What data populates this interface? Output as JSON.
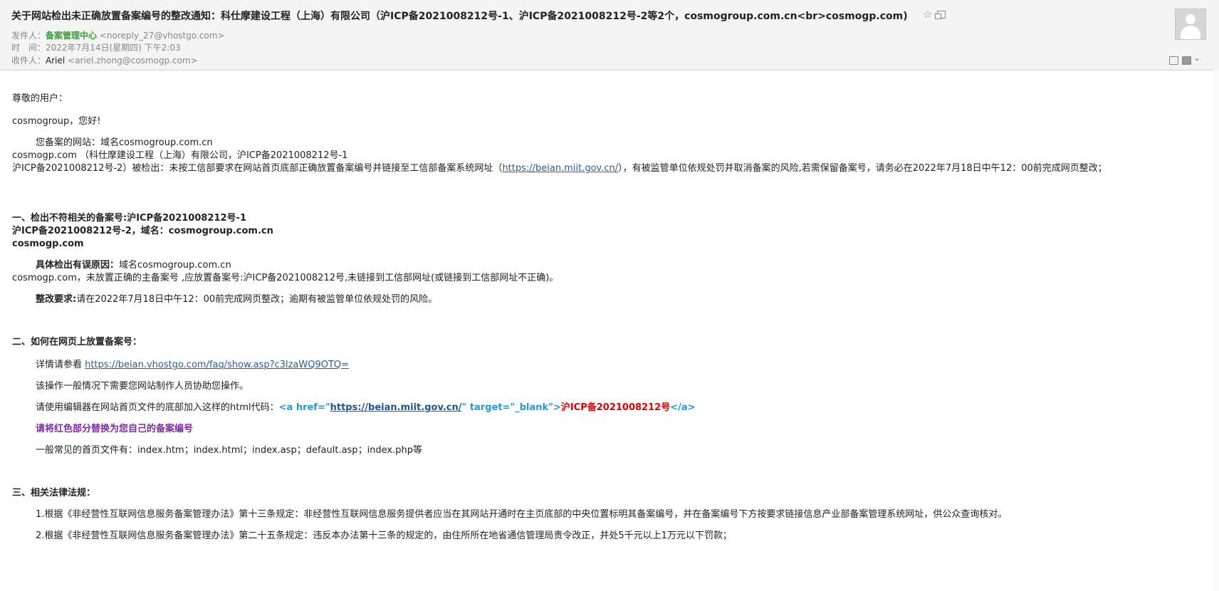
{
  "header": {
    "subject": "关于网站检出未正确放置备案编号的整改通知：科仕摩建设工程（上海）有限公司（沪ICP备2021008212号-1、沪ICP备2021008212号-2等2个，cosmogroup.com.cn<br>cosmogp.com)",
    "from_label": "发件人：",
    "from_name": "备案管理中心",
    "from_addr": "<noreply_27@vhostgo.com>",
    "time_label": "时　间：",
    "time_value": "2022年7月14日(星期四) 下午2:03",
    "to_label": "收件人：",
    "to_name": "Ariel",
    "to_addr": "<ariel.zhong@cosmogp.com>"
  },
  "icons": {
    "star": "star-icon",
    "popout": "popout-icon",
    "avatar": "avatar-icon",
    "note": "note-icon",
    "print": "print-icon",
    "more": "chevron-down-icon"
  },
  "body": {
    "greeting1": "尊敬的用户：",
    "greeting2": "cosmogroup，您好!",
    "p1_line1": "您备案的网站：域名cosmogroup.com.cn",
    "p1_line2": "cosmogp.com （科仕摩建设工程（上海）有限公司，沪ICP备2021008212号-1",
    "p1_line3_a": "沪ICP备2021008212号-2）被检出：未按工信部要求在网站首页底部正确放置备案编号并链接至工信部备案系统网址（",
    "p1_link": "https://beian.miit.gov.cn/",
    "p1_line3_b": "），有被监管单位依规处罚并取消备案的风险,若需保留备案号，请务必在2022年7月18日中午12：00前完成网页整改；",
    "s1_line1": "一、检出不符相关的备案号:沪ICP备2021008212号-1",
    "s1_line2": "沪ICP备2021008212号-2，域名：cosmogroup.com.cn",
    "s1_line3": "cosmogp.com",
    "reason_label": "具体检出有误原因：",
    "reason_line1": "域名cosmogroup.com.cn",
    "reason_line2": "cosmogp.com，未放置正确的主备案号 ,应放置备案号:沪ICP备2021008212号,未链接到工信部网址(或链接到工信部网址不正确)。",
    "req_label": "整改要求:",
    "req_text": "请在2022年7月18日中午12：00前完成网页整改；逾期有被监管单位依规处罚的风险。",
    "s2_title": "二、如何在网页上放置备案号：",
    "detail_prefix": "详情请参看 ",
    "detail_link": "https://beian.vhostgo.com/faq/show.asp?c3lzaWQ9OTQ=",
    "help_text": "该操作一般情况下需要您网站制作人员协助您操作。",
    "code_prefix": "请使用编辑器在网站首页文件的底部加入这样的html代码：",
    "code_a_open": "<a href=\"",
    "code_url": "https://beian.miit.gov.cn/",
    "code_a_rest": "\" target=\"_blank\">",
    "code_icp": "沪ICP备2021008212号",
    "code_a_close": "</a>",
    "replace_note": "请将红色部分替换为您自己的备案编号",
    "files_text": "一般常见的首页文件有：index.htm；index.html；index.asp；default.asp；index.php等",
    "s3_title": "三、相关法律法规：",
    "law1": "1.根据《非经营性互联网信息服务备案管理办法》第十三条规定：非经营性互联网信息服务提供者应当在其网站开通时在主页底部的中央位置标明其备案编号，并在备案编号下方按要求链接信息产业部备案管理系统网址，供公众查询核对。",
    "law2": "2.根据《非经营性互联网信息服务备案管理办法》第二十五条规定：违反本办法第十三条的规定的，由住所所在地省通信管理局责令改正，并处5千元以上1万元以下罚款；"
  }
}
